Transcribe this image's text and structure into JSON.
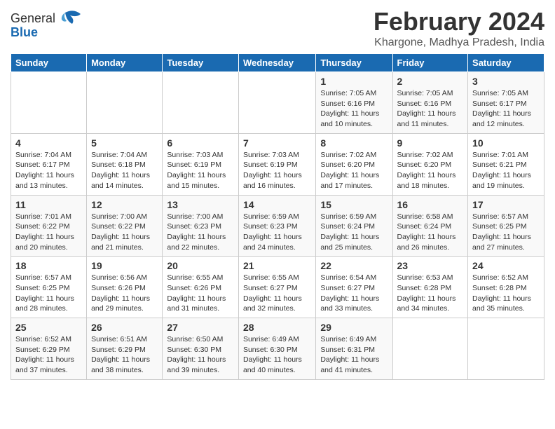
{
  "logo": {
    "general": "General",
    "blue": "Blue",
    "bird_symbol": "🐦"
  },
  "title": "February 2024",
  "location": "Khargone, Madhya Pradesh, India",
  "header": {
    "days": [
      "Sunday",
      "Monday",
      "Tuesday",
      "Wednesday",
      "Thursday",
      "Friday",
      "Saturday"
    ]
  },
  "weeks": [
    {
      "cells": [
        {
          "day": "",
          "info": ""
        },
        {
          "day": "",
          "info": ""
        },
        {
          "day": "",
          "info": ""
        },
        {
          "day": "",
          "info": ""
        },
        {
          "day": "1",
          "info": "Sunrise: 7:05 AM\nSunset: 6:16 PM\nDaylight: 11 hours\nand 10 minutes."
        },
        {
          "day": "2",
          "info": "Sunrise: 7:05 AM\nSunset: 6:16 PM\nDaylight: 11 hours\nand 11 minutes."
        },
        {
          "day": "3",
          "info": "Sunrise: 7:05 AM\nSunset: 6:17 PM\nDaylight: 11 hours\nand 12 minutes."
        }
      ]
    },
    {
      "cells": [
        {
          "day": "4",
          "info": "Sunrise: 7:04 AM\nSunset: 6:17 PM\nDaylight: 11 hours\nand 13 minutes."
        },
        {
          "day": "5",
          "info": "Sunrise: 7:04 AM\nSunset: 6:18 PM\nDaylight: 11 hours\nand 14 minutes."
        },
        {
          "day": "6",
          "info": "Sunrise: 7:03 AM\nSunset: 6:19 PM\nDaylight: 11 hours\nand 15 minutes."
        },
        {
          "day": "7",
          "info": "Sunrise: 7:03 AM\nSunset: 6:19 PM\nDaylight: 11 hours\nand 16 minutes."
        },
        {
          "day": "8",
          "info": "Sunrise: 7:02 AM\nSunset: 6:20 PM\nDaylight: 11 hours\nand 17 minutes."
        },
        {
          "day": "9",
          "info": "Sunrise: 7:02 AM\nSunset: 6:20 PM\nDaylight: 11 hours\nand 18 minutes."
        },
        {
          "day": "10",
          "info": "Sunrise: 7:01 AM\nSunset: 6:21 PM\nDaylight: 11 hours\nand 19 minutes."
        }
      ]
    },
    {
      "cells": [
        {
          "day": "11",
          "info": "Sunrise: 7:01 AM\nSunset: 6:22 PM\nDaylight: 11 hours\nand 20 minutes."
        },
        {
          "day": "12",
          "info": "Sunrise: 7:00 AM\nSunset: 6:22 PM\nDaylight: 11 hours\nand 21 minutes."
        },
        {
          "day": "13",
          "info": "Sunrise: 7:00 AM\nSunset: 6:23 PM\nDaylight: 11 hours\nand 22 minutes."
        },
        {
          "day": "14",
          "info": "Sunrise: 6:59 AM\nSunset: 6:23 PM\nDaylight: 11 hours\nand 24 minutes."
        },
        {
          "day": "15",
          "info": "Sunrise: 6:59 AM\nSunset: 6:24 PM\nDaylight: 11 hours\nand 25 minutes."
        },
        {
          "day": "16",
          "info": "Sunrise: 6:58 AM\nSunset: 6:24 PM\nDaylight: 11 hours\nand 26 minutes."
        },
        {
          "day": "17",
          "info": "Sunrise: 6:57 AM\nSunset: 6:25 PM\nDaylight: 11 hours\nand 27 minutes."
        }
      ]
    },
    {
      "cells": [
        {
          "day": "18",
          "info": "Sunrise: 6:57 AM\nSunset: 6:25 PM\nDaylight: 11 hours\nand 28 minutes."
        },
        {
          "day": "19",
          "info": "Sunrise: 6:56 AM\nSunset: 6:26 PM\nDaylight: 11 hours\nand 29 minutes."
        },
        {
          "day": "20",
          "info": "Sunrise: 6:55 AM\nSunset: 6:26 PM\nDaylight: 11 hours\nand 31 minutes."
        },
        {
          "day": "21",
          "info": "Sunrise: 6:55 AM\nSunset: 6:27 PM\nDaylight: 11 hours\nand 32 minutes."
        },
        {
          "day": "22",
          "info": "Sunrise: 6:54 AM\nSunset: 6:27 PM\nDaylight: 11 hours\nand 33 minutes."
        },
        {
          "day": "23",
          "info": "Sunrise: 6:53 AM\nSunset: 6:28 PM\nDaylight: 11 hours\nand 34 minutes."
        },
        {
          "day": "24",
          "info": "Sunrise: 6:52 AM\nSunset: 6:28 PM\nDaylight: 11 hours\nand 35 minutes."
        }
      ]
    },
    {
      "cells": [
        {
          "day": "25",
          "info": "Sunrise: 6:52 AM\nSunset: 6:29 PM\nDaylight: 11 hours\nand 37 minutes."
        },
        {
          "day": "26",
          "info": "Sunrise: 6:51 AM\nSunset: 6:29 PM\nDaylight: 11 hours\nand 38 minutes."
        },
        {
          "day": "27",
          "info": "Sunrise: 6:50 AM\nSunset: 6:30 PM\nDaylight: 11 hours\nand 39 minutes."
        },
        {
          "day": "28",
          "info": "Sunrise: 6:49 AM\nSunset: 6:30 PM\nDaylight: 11 hours\nand 40 minutes."
        },
        {
          "day": "29",
          "info": "Sunrise: 6:49 AM\nSunset: 6:31 PM\nDaylight: 11 hours\nand 41 minutes."
        },
        {
          "day": "",
          "info": ""
        },
        {
          "day": "",
          "info": ""
        }
      ]
    }
  ]
}
